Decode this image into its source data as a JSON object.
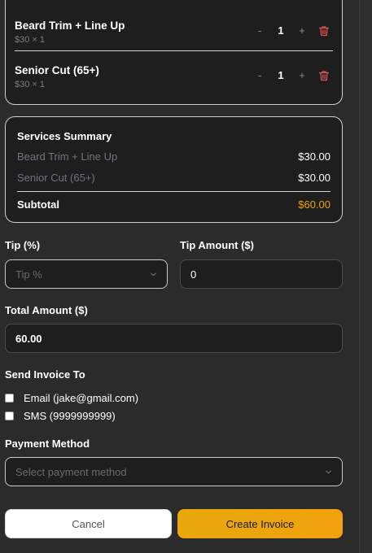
{
  "cart": {
    "items": [
      {
        "name": "Beard Trim + Line Up",
        "price_line": "$30 × 1",
        "minus": "-",
        "qty": "1",
        "plus": "+"
      },
      {
        "name": "Senior Cut (65+)",
        "price_line": "$30 × 1",
        "minus": "-",
        "qty": "1",
        "plus": "+"
      }
    ]
  },
  "summary": {
    "title": "Services Summary",
    "rows": [
      {
        "label": "Beard Trim + Line Up",
        "price": "$30.00"
      },
      {
        "label": "Senior Cut (65+)",
        "price": "$30.00"
      }
    ],
    "subtotal_label": "Subtotal",
    "subtotal_value": "$60.00"
  },
  "form": {
    "tip_label": "Tip (%)",
    "tip_placeholder": "Tip %",
    "tip_amount_label": "Tip Amount ($)",
    "tip_amount_value": "0",
    "total_label": "Total Amount ($)",
    "total_value": "60.00",
    "send_label": "Send Invoice To",
    "email_option": "Email (jake@gmail.com)",
    "sms_option": "SMS (9999999999)",
    "payment_label": "Payment Method",
    "payment_placeholder": "Select payment method"
  },
  "actions": {
    "cancel_label": "Cancel",
    "create_label": "Create Invoice"
  },
  "colors": {
    "accent": "#f0a500",
    "danger": "#e05555",
    "background": "#2b2b2b",
    "panel": "#1e1e1e"
  },
  "icons": {
    "delete": "trash-icon",
    "dropdown": "chevron-down-icon"
  }
}
